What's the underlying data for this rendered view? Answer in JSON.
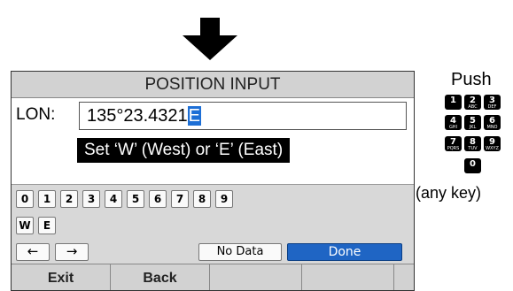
{
  "screen": {
    "title": "POSITION INPUT",
    "field_label": "LON:",
    "field_value": "135°23.4321",
    "cursor_char": "E",
    "hint": "Set ‘W’ (West) or ‘E’ (East)"
  },
  "keyboard": {
    "digits": [
      "0",
      "1",
      "2",
      "3",
      "4",
      "5",
      "6",
      "7",
      "8",
      "9"
    ],
    "letters": [
      "W",
      "E"
    ],
    "left_arrow": "←",
    "right_arrow": "→",
    "no_data": "No Data",
    "done": "Done"
  },
  "softkeys": [
    "Exit",
    "Back",
    "",
    "",
    ""
  ],
  "instruction": {
    "push": "Push",
    "keypad": [
      {
        "num": "1",
        "letters": ""
      },
      {
        "num": "2",
        "letters": "ABC"
      },
      {
        "num": "3",
        "letters": "DEF"
      },
      {
        "num": "4",
        "letters": "GHI"
      },
      {
        "num": "5",
        "letters": "JKL"
      },
      {
        "num": "6",
        "letters": "MNO"
      },
      {
        "num": "7",
        "letters": "PQRS"
      },
      {
        "num": "8",
        "letters": "TUV"
      },
      {
        "num": "9",
        "letters": "WXYZ"
      },
      {
        "num": "0",
        "letters": ""
      }
    ],
    "any_key": "(any key)"
  },
  "colors": {
    "done_button": "#1f65c4",
    "cursor_highlight": "#1d6fd6",
    "bar_gray": "#d2d2d2"
  }
}
